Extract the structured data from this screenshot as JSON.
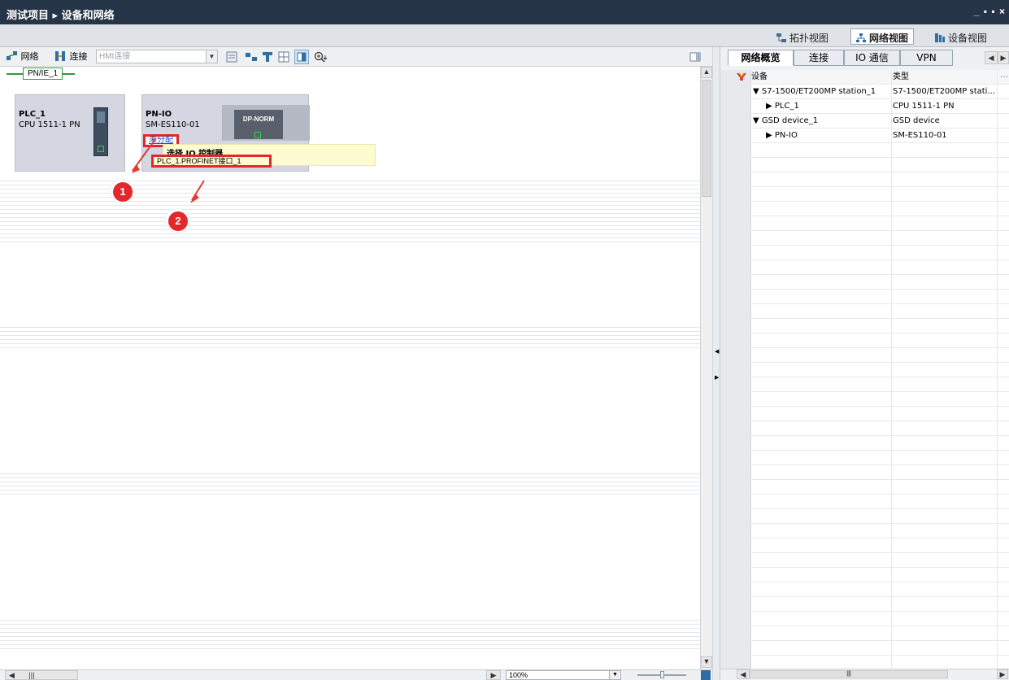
{
  "titlebar": {
    "title": "测试项目 ▸ 设备和网络",
    "window_controls": "_ ▪ ▪ ×"
  },
  "viewbar": {
    "tabs": [
      {
        "label": "拓扑视图",
        "icon": "topology-icon"
      },
      {
        "label": "网络视图",
        "icon": "network-icon",
        "active": true
      },
      {
        "label": "设备视图",
        "icon": "device-icon"
      }
    ]
  },
  "toolbar": {
    "network_label": "网络",
    "connect_label": "连接",
    "hmi_combo": "HMI连接"
  },
  "canvas": {
    "subnet_label": "PN/IE_1",
    "devices": [
      {
        "name": "PLC_1",
        "type": "CPU 1511-1 PN"
      },
      {
        "name": "PN-IO",
        "type": "SM-ES110-01",
        "module": "DP-NORM",
        "link": "未分配"
      }
    ],
    "popup": {
      "title": "选择 IO 控制器",
      "option": "PLC_1.PROFINET接口_1"
    },
    "markers": [
      "1",
      "2"
    ]
  },
  "statusbar": {
    "zoom": "100%"
  },
  "rpanel": {
    "tabs": [
      "网络概览",
      "连接",
      "IO 通信",
      "VPN"
    ],
    "columns": [
      "设备",
      "类型"
    ],
    "rows": [
      {
        "device": "▼  S7-1500/ET200MP station_1",
        "type": "S7-1500/ET200MP stati..."
      },
      {
        "device": "▶  PLC_1",
        "type": "CPU 1511-1 PN"
      },
      {
        "device": "▼  GSD device_1",
        "type": "GSD device"
      },
      {
        "device": "▶  PN-IO",
        "type": "SM-ES110-01"
      }
    ]
  },
  "colors": {
    "titlebar": "#263447",
    "device_box": "#d4d7e1",
    "subnet": "#2d9b3a",
    "highlight": "#e3282b",
    "popup": "#fdfbd0"
  }
}
